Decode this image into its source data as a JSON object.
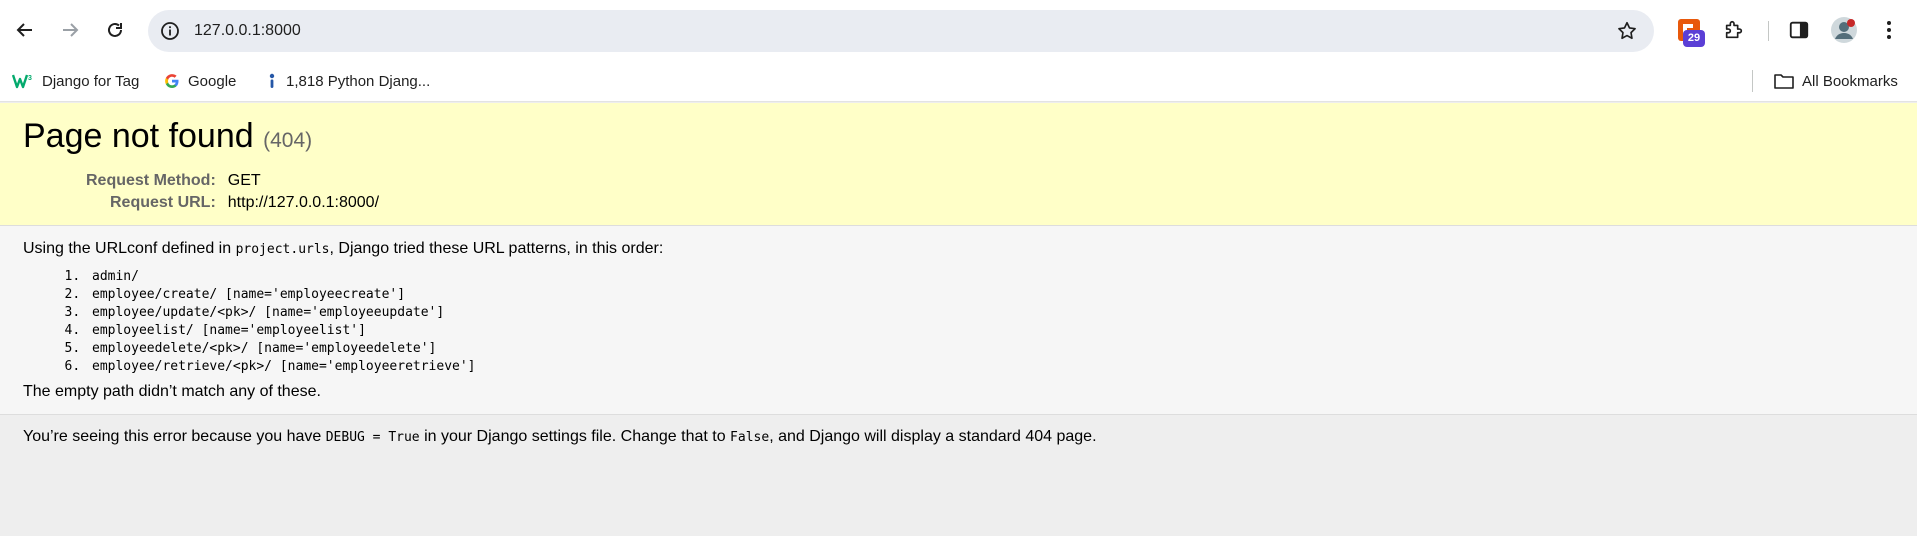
{
  "browser": {
    "url": "127.0.0.1:8000",
    "extension_badge": "29",
    "bookmarks": [
      {
        "label": "Django for Tag",
        "icon": "w3schools-icon"
      },
      {
        "label": "Google",
        "icon": "google-icon"
      },
      {
        "label": "1,818 Python Djang...",
        "icon": "indeed-icon"
      }
    ],
    "all_bookmarks_label": "All Bookmarks"
  },
  "summary": {
    "title": "Page not found",
    "status": "(404)",
    "request_method_label": "Request Method:",
    "request_method": "GET",
    "request_url_label": "Request URL:",
    "request_url": "http://127.0.0.1:8000/"
  },
  "info": {
    "intro_before": "Using the URLconf defined in ",
    "urlconf": "project.urls",
    "intro_after": ", Django tried these URL patterns, in this order:",
    "patterns": [
      "admin/",
      "employee/create/ [name='employeecreate']",
      "employee/update/<pk>/ [name='employeeupdate']",
      "employeelist/ [name='employeelist']",
      "employeedelete/<pk>/ [name='employeedelete']",
      "employee/retrieve/<pk>/ [name='employeeretrieve']"
    ],
    "no_match": "The empty path didn’t match any of these."
  },
  "explanation": {
    "part1": "You’re seeing this error because you have ",
    "code1": "DEBUG = True",
    "part2": " in your Django settings file. Change that to ",
    "code2": "False",
    "part3": ", and Django will display a standard 404 page."
  }
}
